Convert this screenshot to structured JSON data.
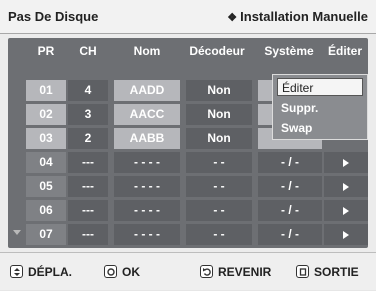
{
  "header": {
    "title": "Pas De Disque",
    "right_label": "Installation Manuelle",
    "right_icon": "diamond-icon"
  },
  "columns": {
    "pr": "PR",
    "ch": "CH",
    "nom": "Nom",
    "decodeur": "Décodeur",
    "systeme": "Système",
    "editer": "Éditer"
  },
  "rows": [
    {
      "pr": "01",
      "ch": "4",
      "nom": "AADD",
      "decodeur": "Non",
      "systeme": "",
      "filled": true
    },
    {
      "pr": "02",
      "ch": "3",
      "nom": "AACC",
      "decodeur": "Non",
      "systeme": "",
      "filled": true
    },
    {
      "pr": "03",
      "ch": "2",
      "nom": "AABB",
      "decodeur": "Non",
      "systeme": "",
      "filled": true
    },
    {
      "pr": "04",
      "ch": "---",
      "nom": "- - - -",
      "decodeur": "- -",
      "systeme": "- / -",
      "filled": false
    },
    {
      "pr": "05",
      "ch": "---",
      "nom": "- - - -",
      "decodeur": "- -",
      "systeme": "- / -",
      "filled": false
    },
    {
      "pr": "06",
      "ch": "---",
      "nom": "- - - -",
      "decodeur": "- -",
      "systeme": "- / -",
      "filled": false
    },
    {
      "pr": "07",
      "ch": "---",
      "nom": "- - - -",
      "decodeur": "- -",
      "systeme": "- / -",
      "filled": false
    }
  ],
  "popup": {
    "items": [
      "Éditer",
      "Suppr.",
      "Swap"
    ],
    "selected": "Éditer"
  },
  "footer": {
    "move": "DÉPLA.",
    "ok": "OK",
    "back": "REVENIR",
    "exit": "SORTIE"
  }
}
